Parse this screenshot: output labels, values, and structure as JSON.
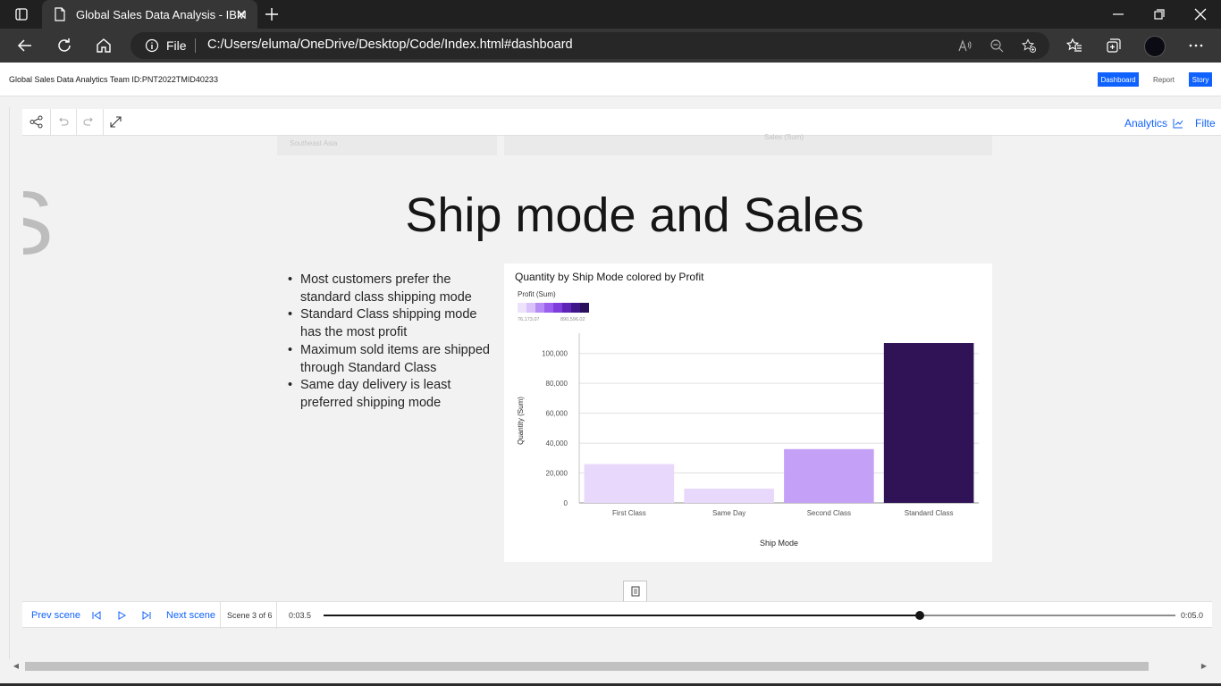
{
  "browser": {
    "tab_title": "Global Sales Data Analysis - IBM",
    "url_scheme": "File",
    "url": "C:/Users/eluma/OneDrive/Desktop/Code/Index.html#dashboard"
  },
  "header": {
    "team_label": "Global Sales Data Analytics Team ID:PNT2022TMID40233",
    "nav": [
      {
        "label": "Dashboard",
        "active": true
      },
      {
        "label": "Report",
        "active": false
      },
      {
        "label": "Story",
        "active": true
      }
    ]
  },
  "toolbar": {
    "analytics_label": "Analytics",
    "filter_label": "Filte"
  },
  "ghost": {
    "region_label": "Southeast Asia",
    "sales_label": "Sales (Sum)",
    "prev_slide_letter": "S"
  },
  "slide": {
    "title": "Ship mode and Sales",
    "bullets": [
      "Most customers prefer the standard class shipping mode",
      "Standard Class shipping mode has the most profit",
      "Maximum sold items are shipped through Standard Class",
      "Same day delivery is least preferred shipping mode"
    ]
  },
  "chart_data": {
    "type": "bar",
    "title": "Quantity by Ship Mode colored by Profit",
    "xlabel": "Ship Mode",
    "ylabel": "Quantity (Sum)",
    "categories": [
      "First Class",
      "Same Day",
      "Second Class",
      "Standard Class"
    ],
    "values": [
      26000,
      9500,
      36000,
      107000
    ],
    "ylim": [
      0,
      110000
    ],
    "yticks": [
      0,
      20000,
      40000,
      60000,
      80000,
      100000
    ],
    "ytick_labels": [
      "0",
      "20,000",
      "40,000",
      "60,000",
      "80,000",
      "100,000"
    ],
    "bar_colors": [
      "#e8d8fb",
      "#e8d8fb",
      "#c4a1f7",
      "#2f1356"
    ],
    "grid": true,
    "legend": {
      "title": "Profit (Sum)",
      "min_label": "76,173.07",
      "max_label": "890,596.02",
      "colors": [
        "#ede2fc",
        "#d9c2fa",
        "#b78bf5",
        "#9b5fee",
        "#7f3ddd",
        "#5e24b6",
        "#3f158a",
        "#2a0f5c"
      ],
      "placement": "top-left"
    }
  },
  "playback": {
    "prev_label": "Prev scene",
    "next_label": "Next scene",
    "scene_label": "Scene 3 of 6",
    "current_time": "0:03.5",
    "total_time": "0:05.0",
    "progress_fraction": 0.7
  }
}
